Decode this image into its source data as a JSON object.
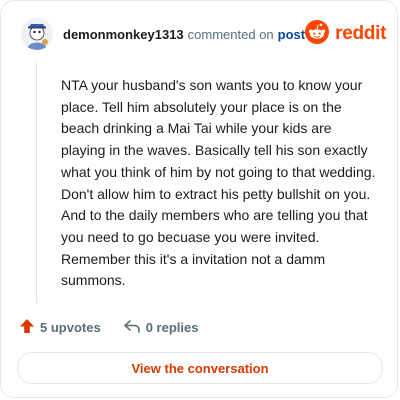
{
  "header": {
    "username": "demonmonkey1313",
    "action_text": "commented on",
    "post_link": "post",
    "brand_word": "reddit",
    "brand_color": "#ff4500"
  },
  "comment": {
    "body": "NTA your husband's son wants you to know your place. Tell him absolutely your place is on the beach drinking a Mai Tai while your kids are playing in the waves. Basically tell his son exactly what you think of him by not going to that wedding. Don't allow him to extract his petty bullshit on you. And to the daily members who are telling you that you need to go becuase you were invited. Remember this it's a invitation not a damm summons."
  },
  "actions": {
    "upvotes": "5 upvotes",
    "replies": "0 replies",
    "upvote_icon": "upvote-arrow-icon",
    "reply_icon": "reply-arrow-icon",
    "upvote_color": "#d93900"
  },
  "cta": {
    "label": "View the conversation",
    "color": "#d93900"
  }
}
